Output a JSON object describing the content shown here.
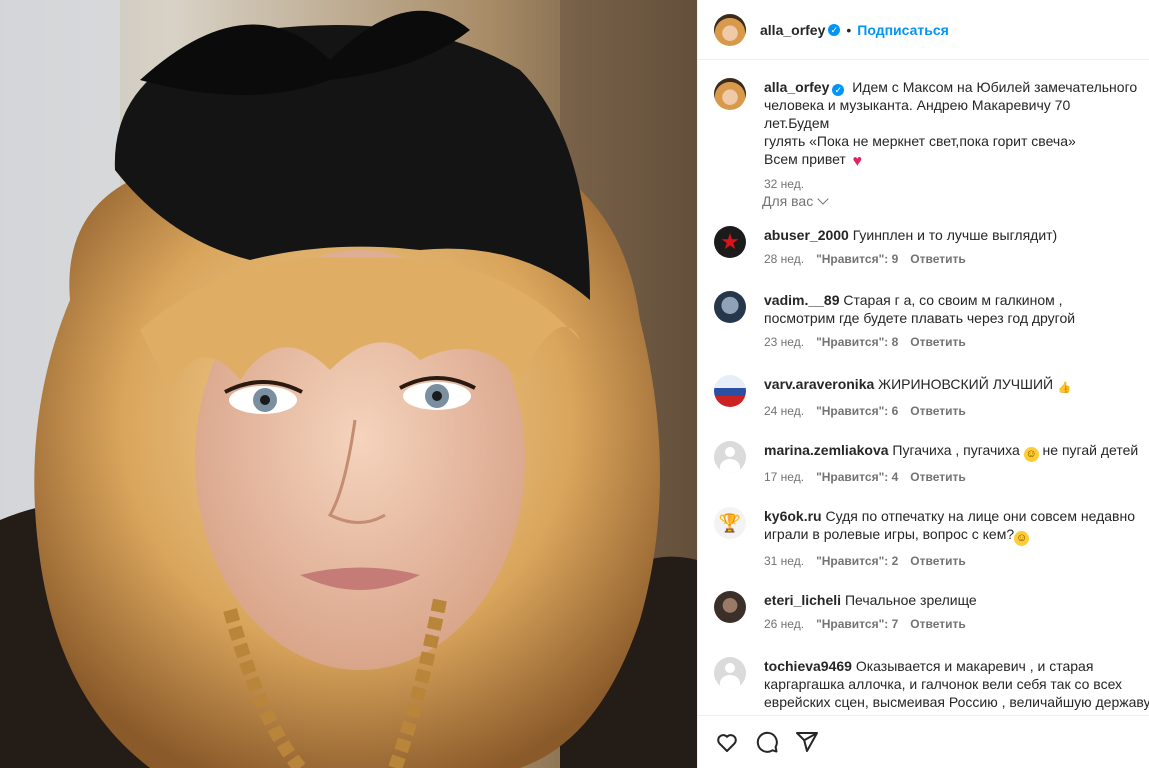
{
  "post": {
    "author": "alla_orfey",
    "follow_label": "Подписаться",
    "dot": "•",
    "caption_lines": [
      "Идем с Максом на Юбилей замечательного",
      "человека и музыканта. Андрею Макаревичу 70 лет.Будем",
      "гулять «Пока не меркнет свет,пока горит свеча»",
      "Всем привет"
    ],
    "caption_time": "32 нед.",
    "sort_label": "Для вас"
  },
  "comments": [
    {
      "user": "abuser_2000",
      "lines": [
        "Гуинплен и то лучше выглядит)"
      ],
      "time": "28 нед.",
      "likes": "\"Нравится\": 9",
      "reply": "Ответить",
      "avatar": "red-star"
    },
    {
      "user": "vadim.__89",
      "lines": [
        "Старая г    а, со своим     м галкином ,",
        "посмотрим где будете плавать через год другой"
      ],
      "time": "23 нед.",
      "likes": "\"Нравится\": 8",
      "reply": "Ответить",
      "avatar": "photo"
    },
    {
      "user": "varv.araveronika",
      "lines": [
        "ЖИРИНОВСКИЙ ЛУЧШИЙ"
      ],
      "time": "24 нед.",
      "likes": "\"Нравится\": 6",
      "reply": "Ответить",
      "avatar": "flag"
    },
    {
      "user": "marina.zemliakova",
      "lines": [
        "Пугачиха , пугачиха",
        "не пугай детей"
      ],
      "time": "17 нед.",
      "likes": "\"Нравится\": 4",
      "reply": "Ответить",
      "avatar": "default"
    },
    {
      "user": "ky6ok.ru",
      "lines": [
        "Судя по отпечатку на лице они совсем недавно",
        "играли в ролевые игры, вопрос с кем?"
      ],
      "time": "31 нед.",
      "likes": "\"Нравится\": 2",
      "reply": "Ответить",
      "avatar": "cup"
    },
    {
      "user": "eteri_licheli",
      "lines": [
        "Печальное зрелище"
      ],
      "time": "26 нед.",
      "likes": "\"Нравится\": 7",
      "reply": "Ответить",
      "avatar": "photo"
    },
    {
      "user": "tochieva9469",
      "lines": [
        "Оказывается и макаревич , и старая",
        "каргаргашка аллочка, и галчонок вели себя так со всех",
        "еврейских сцен, высмеивая Россию , величайшую державу,"
      ],
      "avatar": "default"
    }
  ],
  "icons": {
    "heart": "heart-icon",
    "comment": "comment-icon",
    "share": "share-icon",
    "verified": "verified-badge-icon"
  },
  "colors": {
    "accent": "#0095f6",
    "muted": "#737373",
    "text": "#262626"
  }
}
